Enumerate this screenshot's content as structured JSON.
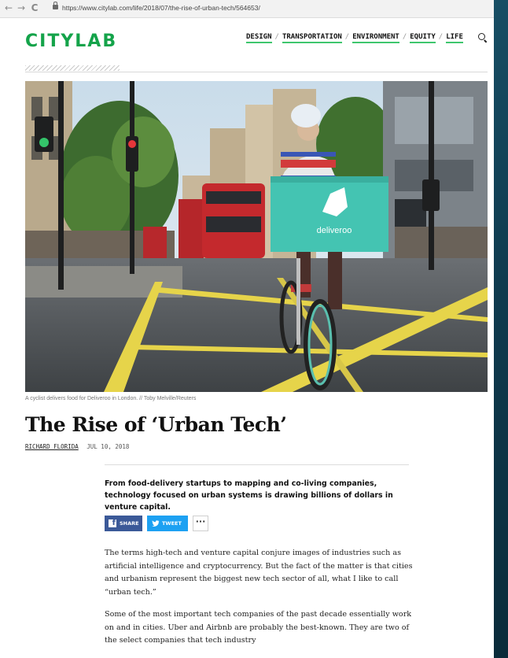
{
  "browser": {
    "back_icon": "←",
    "forward_icon": "→",
    "reload_icon": "C",
    "url": "https://www.citylab.com/life/2018/07/the-rise-of-urban-tech/564653/"
  },
  "site": {
    "logo": "CITYLAB",
    "nav": [
      "DESIGN",
      "TRANSPORTATION",
      "ENVIRONMENT",
      "EQUITY",
      "LIFE"
    ],
    "nav_separator": "/"
  },
  "hero": {
    "box_brand": "deliveroo",
    "caption": "A cyclist delivers food for Deliveroo in London. // Toby Melville/Reuters"
  },
  "article": {
    "headline": "The Rise of ‘Urban Tech’",
    "author": "RICHARD FLORIDA",
    "date": "JUL 10, 2018",
    "dek": "From food-delivery startups to mapping and co-living companies, technology focused on urban systems is drawing billions of dollars in venture capital.",
    "share": {
      "facebook": "SHARE",
      "twitter": "TWEET",
      "more": "···"
    },
    "paragraphs": [
      "The terms high-tech and venture capital conjure images of industries such as artificial intelligence and cryptocurrency. But the fact of the matter is that cities and urbanism represent the biggest new tech sector of all, what I like to call “urban tech.”",
      "Some of the most important tech companies of the past decade essentially work on and in cities. Uber and Airbnb are probably the best-known. They are two of the select companies that tech industry"
    ]
  },
  "colors": {
    "logo_green": "#14a34a",
    "nav_underline": "#3fc66e",
    "facebook": "#3b5998",
    "twitter": "#1da1f2",
    "deliveroo_teal": "#44c4b2"
  }
}
